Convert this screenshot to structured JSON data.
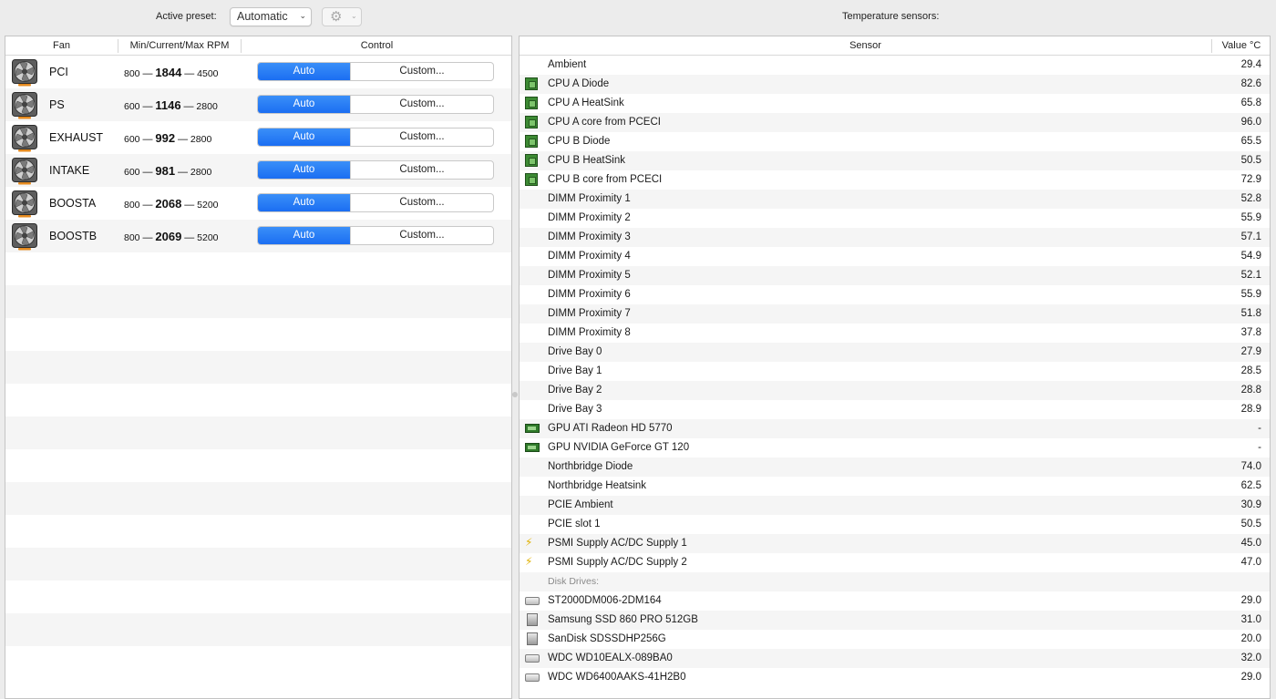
{
  "toolbar": {
    "active_preset_label": "Active preset:",
    "preset_value": "Automatic",
    "temperature_sensors_label": "Temperature sensors:"
  },
  "fan_table": {
    "headers": {
      "fan": "Fan",
      "rpm": "Min/Current/Max RPM",
      "control": "Control"
    },
    "rows": [
      {
        "name": "PCI",
        "min": "800",
        "current": "1844",
        "max": "4500",
        "mode_auto": "Auto",
        "mode_custom": "Custom..."
      },
      {
        "name": "PS",
        "min": "600",
        "current": "1146",
        "max": "2800",
        "mode_auto": "Auto",
        "mode_custom": "Custom..."
      },
      {
        "name": "EXHAUST",
        "min": "600",
        "current": "992",
        "max": "2800",
        "mode_auto": "Auto",
        "mode_custom": "Custom..."
      },
      {
        "name": "INTAKE",
        "min": "600",
        "current": "981",
        "max": "2800",
        "mode_auto": "Auto",
        "mode_custom": "Custom..."
      },
      {
        "name": "BOOSTA",
        "min": "800",
        "current": "2068",
        "max": "5200",
        "mode_auto": "Auto",
        "mode_custom": "Custom..."
      },
      {
        "name": "BOOSTB",
        "min": "800",
        "current": "2069",
        "max": "5200",
        "mode_auto": "Auto",
        "mode_custom": "Custom..."
      }
    ],
    "dash": "—"
  },
  "sensor_table": {
    "headers": {
      "sensor": "Sensor",
      "value": "Value °C"
    },
    "rows": [
      {
        "icon": "none",
        "name": "Ambient",
        "value": "29.4"
      },
      {
        "icon": "cpu-chip-icon",
        "name": "CPU A Diode",
        "value": "82.6"
      },
      {
        "icon": "cpu-chip-icon",
        "name": "CPU A HeatSink",
        "value": "65.8"
      },
      {
        "icon": "cpu-chip-icon",
        "name": "CPU A core from PCECI",
        "value": "96.0"
      },
      {
        "icon": "cpu-chip-icon",
        "name": "CPU B Diode",
        "value": "65.5"
      },
      {
        "icon": "cpu-chip-icon",
        "name": "CPU B HeatSink",
        "value": "50.5"
      },
      {
        "icon": "cpu-chip-icon",
        "name": "CPU B core from PCECI",
        "value": "72.9"
      },
      {
        "icon": "none",
        "name": "DIMM Proximity 1",
        "value": "52.8"
      },
      {
        "icon": "none",
        "name": "DIMM Proximity 2",
        "value": "55.9"
      },
      {
        "icon": "none",
        "name": "DIMM Proximity 3",
        "value": "57.1"
      },
      {
        "icon": "none",
        "name": "DIMM Proximity 4",
        "value": "54.9"
      },
      {
        "icon": "none",
        "name": "DIMM Proximity 5",
        "value": "52.1"
      },
      {
        "icon": "none",
        "name": "DIMM Proximity 6",
        "value": "55.9"
      },
      {
        "icon": "none",
        "name": "DIMM Proximity 7",
        "value": "51.8"
      },
      {
        "icon": "none",
        "name": "DIMM Proximity 8",
        "value": "37.8"
      },
      {
        "icon": "none",
        "name": "Drive Bay 0",
        "value": "27.9"
      },
      {
        "icon": "none",
        "name": "Drive Bay 1",
        "value": "28.5"
      },
      {
        "icon": "none",
        "name": "Drive Bay 2",
        "value": "28.8"
      },
      {
        "icon": "none",
        "name": "Drive Bay 3",
        "value": "28.9"
      },
      {
        "icon": "gpu-card-icon",
        "name": "GPU ATI Radeon HD 5770",
        "value": "-"
      },
      {
        "icon": "gpu-card-icon",
        "name": "GPU NVIDIA GeForce GT 120",
        "value": "-"
      },
      {
        "icon": "none",
        "name": "Northbridge Diode",
        "value": "74.0"
      },
      {
        "icon": "none",
        "name": "Northbridge Heatsink",
        "value": "62.5"
      },
      {
        "icon": "none",
        "name": "PCIE Ambient",
        "value": "30.9"
      },
      {
        "icon": "none",
        "name": "PCIE slot 1",
        "value": "50.5"
      },
      {
        "icon": "power-bolt-icon",
        "name": "PSMI Supply AC/DC Supply 1",
        "value": "45.0"
      },
      {
        "icon": "power-bolt-icon",
        "name": "PSMI Supply AC/DC Supply 2",
        "value": "47.0"
      },
      {
        "icon": "group",
        "name": "Disk Drives:",
        "value": ""
      },
      {
        "icon": "hard-drive-icon",
        "name": "ST2000DM006-2DM164",
        "value": "29.0"
      },
      {
        "icon": "ssd-icon",
        "name": "Samsung SSD 860 PRO 512GB",
        "value": "31.0"
      },
      {
        "icon": "ssd-icon",
        "name": "SanDisk SDSSDHP256G",
        "value": "20.0"
      },
      {
        "icon": "hard-drive-icon",
        "name": "WDC WD10EALX-089BA0",
        "value": "32.0"
      },
      {
        "icon": "hard-drive-icon",
        "name": "WDC WD6400AAKS-41H2B0",
        "value": "29.0"
      }
    ]
  },
  "colors": {
    "accent": "#1b6ef2",
    "stripe": "#f5f5f5",
    "window_bg": "#ececec"
  }
}
